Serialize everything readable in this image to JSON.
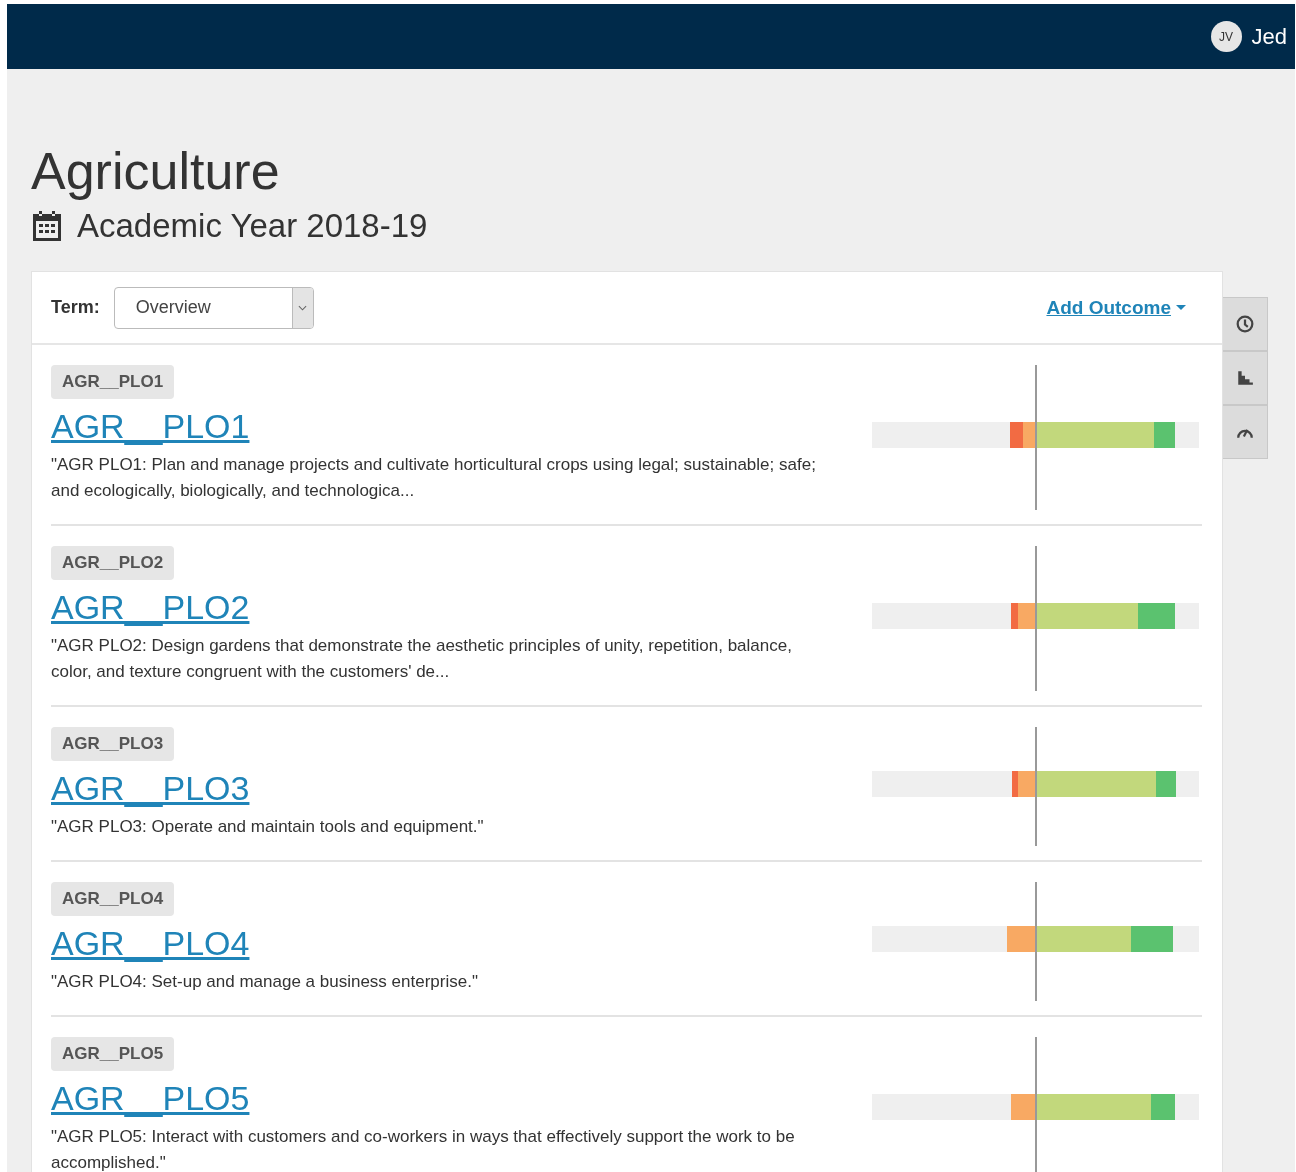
{
  "user": {
    "initials": "JV",
    "name": "Jed"
  },
  "program": {
    "title": "Agriculture",
    "year": "Academic Year 2018-19"
  },
  "toolbar": {
    "term_label": "Term:",
    "term_value": "Overview",
    "add_link": "Add Outcome"
  },
  "side_buttons": [
    {
      "kind": "clock"
    },
    {
      "kind": "bars"
    },
    {
      "kind": "gauge"
    }
  ],
  "outcomes": [
    {
      "tag": "AGR__PLO1",
      "title": "AGR__PLO1",
      "description": "\"AGR PLO1: Plan and manage projects and cultivate horticultural crops using legal; sustainable; safe; and ecologically, biologically, and technologica...",
      "segments": [
        {
          "kind": "below",
          "color": "#f26b43"
        },
        {
          "kind": "below",
          "color": "#f8a963"
        },
        {
          "kind": "above",
          "color": "#c2d87c"
        },
        {
          "kind": "above",
          "color": "#5bc26f"
        }
      ]
    },
    {
      "tag": "AGR__PLO2",
      "title": "AGR__PLO2",
      "description": "\"AGR PLO2: Design gardens that demonstrate the aesthetic principles of unity, repetition, balance, color, and texture congruent with the customers' de...",
      "segments": [
        {
          "kind": "below",
          "color": "#f26b43"
        },
        {
          "kind": "below",
          "color": "#f8a963"
        },
        {
          "kind": "above",
          "color": "#c2d87c"
        },
        {
          "kind": "above",
          "color": "#5bc26f"
        }
      ]
    },
    {
      "tag": "AGR__PLO3",
      "title": "AGR__PLO3",
      "description": "\"AGR PLO3: Operate and maintain tools and equipment.\"",
      "segments": [
        {
          "kind": "below",
          "color": "#f26b43"
        },
        {
          "kind": "below",
          "color": "#f8a963"
        },
        {
          "kind": "above",
          "color": "#c2d87c"
        },
        {
          "kind": "above",
          "color": "#5bc26f"
        }
      ]
    },
    {
      "tag": "AGR__PLO4",
      "title": "AGR__PLO4",
      "description": "\"AGR PLO4: Set-up and manage a business enterprise.\"",
      "segments": [
        {
          "kind": "below",
          "color": "#f8a963"
        },
        {
          "kind": "above",
          "color": "#c2d87c"
        },
        {
          "kind": "above",
          "color": "#5bc26f"
        }
      ]
    },
    {
      "tag": "AGR__PLO5",
      "title": "AGR__PLO5",
      "description": "\"AGR PLO5: Interact with customers and co-workers in ways that effectively support the work to be accomplished.\"",
      "segments": [
        {
          "kind": "below",
          "color": "#f8a963"
        },
        {
          "kind": "above",
          "color": "#c2d87c"
        },
        {
          "kind": "above",
          "color": "#5bc26f"
        }
      ]
    }
  ]
}
